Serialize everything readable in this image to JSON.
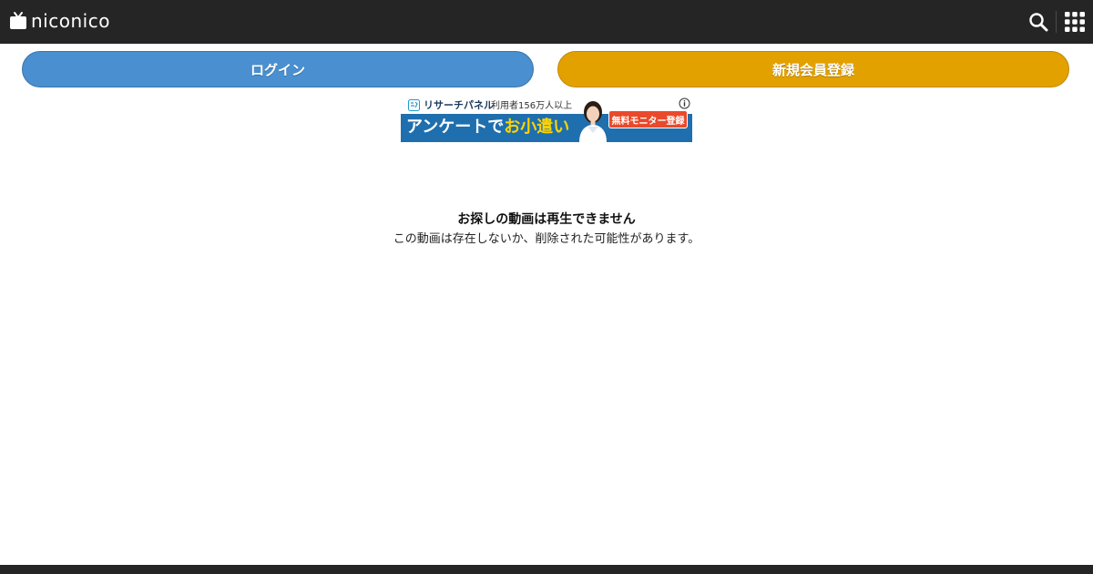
{
  "header": {
    "logo_text": "niconico",
    "search_icon": "search-icon",
    "menu_icon": "grid-menu-icon"
  },
  "actions": {
    "login_label": "ログイン",
    "register_label": "新規会員登録"
  },
  "colors": {
    "header_bg": "#252525",
    "login_bg": "#4a8fcf",
    "register_bg": "#e3a100"
  },
  "ad": {
    "brand": "リサーチパネル",
    "users": "利用者156万人以上",
    "headline_main": "アンケートで",
    "headline_highlight": "お小遣い",
    "cta": "無料モニター登録"
  },
  "message": {
    "title": "お探しの動画は再生できません",
    "body": "この動画は存在しないか、削除された可能性があります。"
  }
}
